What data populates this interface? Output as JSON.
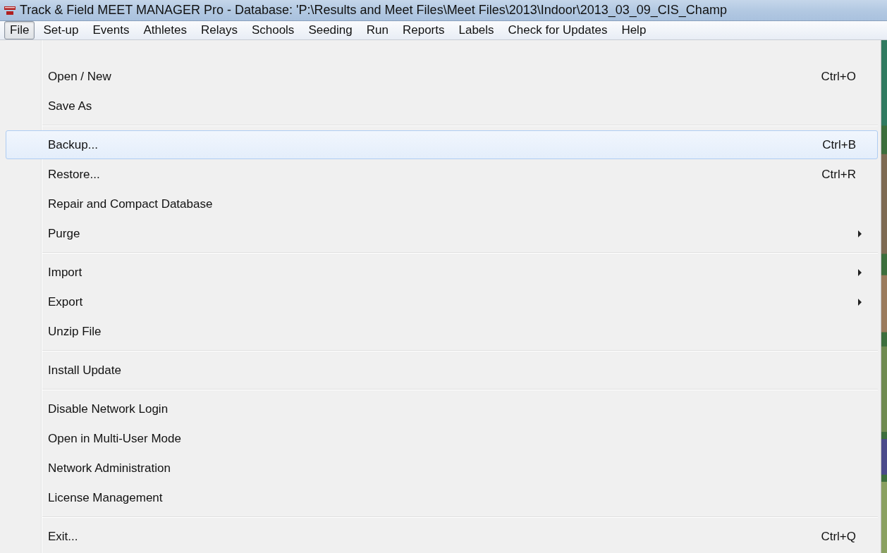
{
  "window": {
    "title": "Track & Field MEET MANAGER Pro - Database: 'P:\\Results and Meet Files\\Meet Files\\2013\\Indoor\\2013_03_09_CIS_Champ"
  },
  "menubar": [
    {
      "label": "File",
      "selected": true
    },
    {
      "label": "Set-up",
      "selected": false
    },
    {
      "label": "Events",
      "selected": false
    },
    {
      "label": "Athletes",
      "selected": false
    },
    {
      "label": "Relays",
      "selected": false
    },
    {
      "label": "Schools",
      "selected": false
    },
    {
      "label": "Seeding",
      "selected": false
    },
    {
      "label": "Run",
      "selected": false
    },
    {
      "label": "Reports",
      "selected": false
    },
    {
      "label": "Labels",
      "selected": false
    },
    {
      "label": "Check for Updates",
      "selected": false
    },
    {
      "label": "Help",
      "selected": false
    }
  ],
  "file_menu": [
    {
      "kind": "item",
      "label": "Open / New",
      "shortcut": "Ctrl+O",
      "submenu": false,
      "selected": false
    },
    {
      "kind": "item",
      "label": "Save As",
      "submenu": false,
      "selected": false
    },
    {
      "kind": "separator"
    },
    {
      "kind": "item",
      "label": "Backup...",
      "shortcut": "Ctrl+B",
      "submenu": false,
      "selected": true
    },
    {
      "kind": "item",
      "label": "Restore...",
      "shortcut": "Ctrl+R",
      "submenu": false,
      "selected": false
    },
    {
      "kind": "item",
      "label": "Repair and Compact Database",
      "submenu": false,
      "selected": false
    },
    {
      "kind": "item",
      "label": "Purge",
      "submenu": true,
      "selected": false
    },
    {
      "kind": "separator"
    },
    {
      "kind": "item",
      "label": "Import",
      "submenu": true,
      "selected": false
    },
    {
      "kind": "item",
      "label": "Export",
      "submenu": true,
      "selected": false
    },
    {
      "kind": "item",
      "label": "Unzip File",
      "submenu": false,
      "selected": false
    },
    {
      "kind": "separator"
    },
    {
      "kind": "item",
      "label": "Install Update",
      "submenu": false,
      "selected": false
    },
    {
      "kind": "separator"
    },
    {
      "kind": "item",
      "label": "Disable Network Login",
      "submenu": false,
      "selected": false
    },
    {
      "kind": "item",
      "label": "Open in Multi-User Mode",
      "submenu": false,
      "selected": false
    },
    {
      "kind": "item",
      "label": "Network Administration",
      "submenu": false,
      "selected": false
    },
    {
      "kind": "item",
      "label": "License Management",
      "submenu": false,
      "selected": false
    },
    {
      "kind": "separator"
    },
    {
      "kind": "item",
      "label": "Exit...",
      "shortcut": "Ctrl+Q",
      "submenu": false,
      "selected": false
    }
  ]
}
